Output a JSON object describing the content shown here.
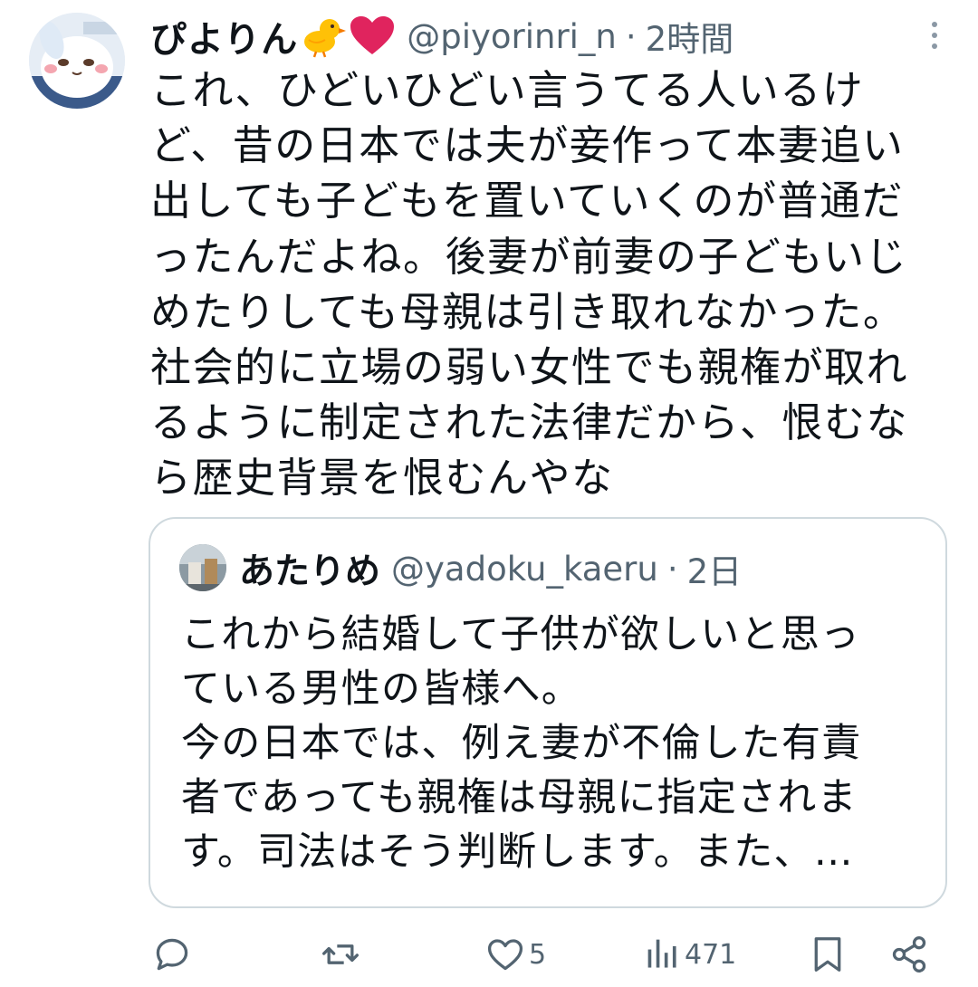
{
  "tweet": {
    "display_name": "ぴよりん",
    "name_emoji": [
      "chick-emoji",
      "red-heart-emoji"
    ],
    "handle": "@piyorinri_n",
    "separator": "·",
    "time": "2時間",
    "text_lines": [
      "これ、ひどいひどい言うてる人いるけ",
      "ど、昔の日本では夫が妾作って本妻追い",
      "出しても子どもを置いていくのが普通だ",
      "ったんだよね。後妻が前妻の子どもいじ",
      "めたりしても母親は引き取れなかった。",
      "社会的に立場の弱い女性でも親権が取れ",
      "るように制定された法律だから、恨むな",
      "ら歴史背景を恨むんやな"
    ]
  },
  "quote": {
    "display_name": "あたりめ",
    "handle": "@yadoku_kaeru",
    "separator": "·",
    "time": "2日",
    "text_lines": [
      "これから結婚して子供が欲しいと思っ",
      "ている男性の皆様へ。",
      "今の日本では、例え妻が不倫した有責",
      "者であっても親権は母親に指定されま",
      "す。司法はそう判断します。また、…"
    ]
  },
  "actions": {
    "reply_icon": "reply-icon",
    "retweet_icon": "retweet-icon",
    "like_icon": "heart-icon",
    "like_count": "5",
    "views_icon": "views-icon",
    "views_count": "471",
    "bookmark_icon": "bookmark-icon",
    "share_icon": "share-icon"
  },
  "colors": {
    "text_primary": "#0f1419",
    "text_secondary": "#536471",
    "border": "#cfd9de",
    "heart_red": "#e0245e",
    "chick_yellow": "#ffc107"
  }
}
